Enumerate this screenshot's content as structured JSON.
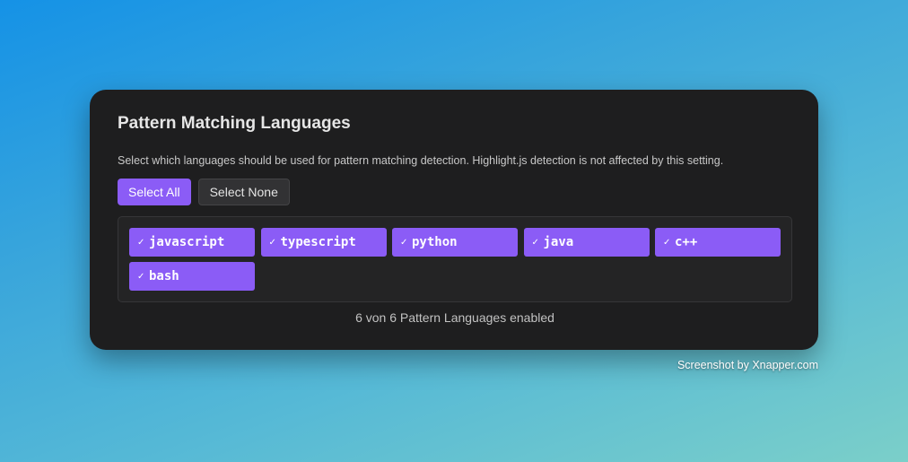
{
  "panel": {
    "title": "Pattern Matching Languages",
    "description": "Select which languages should be used for pattern matching detection. Highlight.js detection is not affected by this setting.",
    "select_all_label": "Select All",
    "select_none_label": "Select None",
    "languages": [
      {
        "check": "✓",
        "name": "javascript",
        "enabled": true
      },
      {
        "check": "✓",
        "name": "typescript",
        "enabled": true
      },
      {
        "check": "✓",
        "name": "python",
        "enabled": true
      },
      {
        "check": "✓",
        "name": "java",
        "enabled": true
      },
      {
        "check": "✓",
        "name": "c++",
        "enabled": true
      },
      {
        "check": "✓",
        "name": "bash",
        "enabled": true
      }
    ],
    "status": "6 von 6 Pattern Languages enabled"
  },
  "credit": "Screenshot by Xnapper.com",
  "colors": {
    "accent": "#8b5cf6",
    "panel_bg": "#1e1e1f"
  }
}
